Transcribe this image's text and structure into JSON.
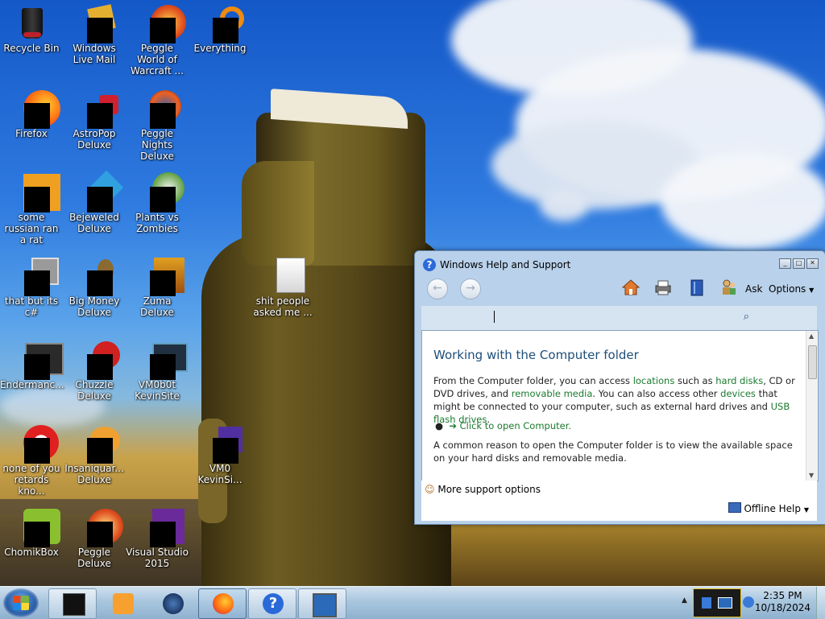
{
  "desktop": {
    "icons": [
      {
        "label": "Recycle Bin",
        "icon": "recycle-bin-icon"
      },
      {
        "label": "Windows Live Mail",
        "icon": "mail-icon"
      },
      {
        "label": "Peggle World of Warcraft ...",
        "icon": "peggle-icon"
      },
      {
        "label": "Everything",
        "icon": "search-app-icon"
      },
      {
        "label": "Firefox",
        "icon": "firefox-icon"
      },
      {
        "label": "AstroPop Deluxe",
        "icon": "game-icon"
      },
      {
        "label": "Peggle Nights Deluxe",
        "icon": "peggle-icon"
      },
      {
        "label": "some russian ran a rat",
        "icon": "app-icon"
      },
      {
        "label": "Bejeweled Deluxe",
        "icon": "game-icon"
      },
      {
        "label": "Plants vs Zombies",
        "icon": "game-icon"
      },
      {
        "label": "that but its c#",
        "icon": "shortcut-icon"
      },
      {
        "label": "Big Money Deluxe",
        "icon": "game-icon"
      },
      {
        "label": "Zuma Deluxe",
        "icon": "game-icon"
      },
      {
        "label": "Endermanc...",
        "icon": "app-icon"
      },
      {
        "label": "Chuzzle Deluxe",
        "icon": "game-icon"
      },
      {
        "label": "VM0b0t KevinSite",
        "icon": "shortcut-icon"
      },
      {
        "label": "none of you retards kno...",
        "icon": "app-icon"
      },
      {
        "label": "Insaniquar... Deluxe",
        "icon": "game-icon"
      },
      {
        "label": "VM0 KevinSi...",
        "icon": "shortcut-icon"
      },
      {
        "label": "ChomikBox",
        "icon": "app-icon"
      },
      {
        "label": "Peggle Deluxe",
        "icon": "peggle-icon"
      },
      {
        "label": "Visual Studio 2015",
        "icon": "visual-studio-icon"
      },
      {
        "label": "shit people asked me ...",
        "icon": "file-icon"
      }
    ]
  },
  "help_window": {
    "title": "Windows Help and Support",
    "toolbar": {
      "ask": "Ask",
      "options": "Options"
    },
    "article": {
      "heading": "Working with the Computer folder",
      "p1": {
        "t1": "From the Computer folder, you can access ",
        "l1": "locations",
        "t2": " such as ",
        "l2": "hard disks",
        "t3": ", CD or DVD drives, and ",
        "l3": "removable media",
        "t4": ". You can also access other ",
        "l4": "devices",
        "t5": " that might be connected to your computer, such as external hard drives and ",
        "l5": "USB flash drives",
        "t6": "."
      },
      "link_open": "Click to open Computer.",
      "p2": "A common reason to open the Computer folder is to view the available space on your hard disks and removable media."
    },
    "more_support": "More support options",
    "offline_help": "Offline Help"
  },
  "taskbar": {
    "clock_time": "2:35 PM",
    "clock_date": "10/18/2024"
  },
  "colors": {
    "link": "#1a7a2e",
    "heading": "#1e4e79",
    "taskbar": "#a9c6de"
  }
}
